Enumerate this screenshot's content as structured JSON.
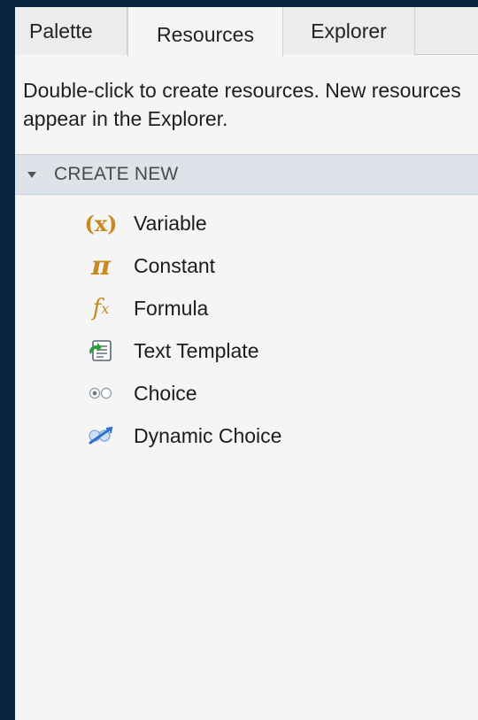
{
  "tabs": [
    {
      "label": "Palette",
      "active": false
    },
    {
      "label": "Resources",
      "active": true
    },
    {
      "label": "Explorer",
      "active": false
    }
  ],
  "help_text": "Double-click to create resources. New resources appear in the Explorer.",
  "section": {
    "title": "CREATE NEW",
    "expanded": true
  },
  "items": [
    {
      "label": "Variable",
      "icon": "variable-icon",
      "glyph": "(x)"
    },
    {
      "label": "Constant",
      "icon": "constant-pi-icon",
      "glyph": "π"
    },
    {
      "label": "Formula",
      "icon": "formula-fx-icon",
      "glyph": "f",
      "glyph_sup": "x"
    },
    {
      "label": "Text Template",
      "icon": "text-template-icon"
    },
    {
      "label": "Choice",
      "icon": "choice-radio-icon"
    },
    {
      "label": "Dynamic Choice",
      "icon": "dynamic-choice-icon"
    }
  ],
  "colors": {
    "accent_orange": "#c88a1e",
    "header_bg": "#dde3e8",
    "frame_navy": "#0b2540"
  }
}
